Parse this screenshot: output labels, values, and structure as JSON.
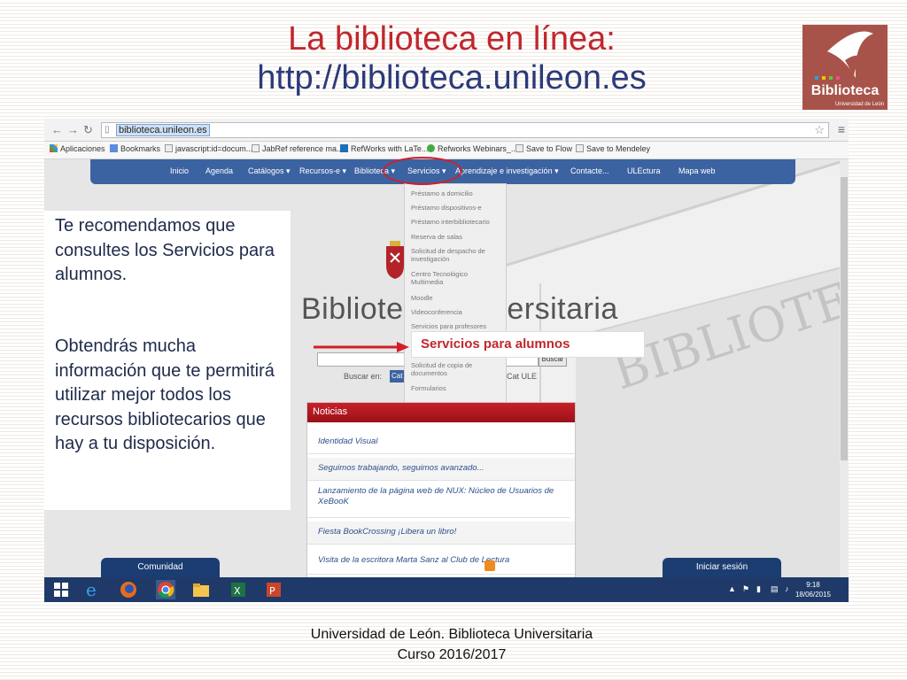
{
  "slide": {
    "title_line1": "La biblioteca en línea:",
    "title_line2": "http://biblioteca.unileon.es",
    "left_text_1": "Te recomendamos que consultes los Servicios para alumnos.",
    "left_text_2": "Obtendrás mucha información que te permitirá utilizar mejor todos los recursos bibliotecarios que hay a tu disposición.",
    "callout": "Servicios para alumnos",
    "footer_line1": "Universidad de León. Biblioteca Universitaria",
    "footer_line2": "Curso 2016/2017",
    "logo_text": "Biblioteca",
    "logo_sub": "Universidad de León"
  },
  "browser": {
    "url": "biblioteca.unileon.es",
    "bookmarks": [
      "Aplicaciones",
      "Bookmarks",
      "javascript:id=docum...",
      "JabRef reference ma...",
      "RefWorks with LaTe...",
      "Refworks Webinars_...",
      "Save to Flow",
      "Save to Mendeley"
    ]
  },
  "site": {
    "nav": [
      "Inicio",
      "Agenda",
      "Catálogos ▾",
      "Recursos-e ▾",
      "Biblioteca ▾",
      "Servicios ▾",
      "Aprendizaje e investigación ▾",
      "Contacte...",
      "ULEctura",
      "Mapa web"
    ],
    "submenu": [
      "Préstamo a domicilio",
      "Préstamo dispositivos-e",
      "Préstamo interbibliotecario",
      "Reserva de salas",
      "Solicitud de despacho de investigación",
      "Centro Tecnológico Multimedia",
      "Moodle",
      "Videoconferencia",
      "Servicios para profesores",
      "Servicios para alumnos",
      "Solicitud de copia de documentos",
      "Formularios"
    ],
    "site_name": "Biblioteca Universitaria",
    "buscar_label": "Buscar en:",
    "buscar_button": "Buscar",
    "cat_chip": "Cat",
    "cat_ule": "Cat ULE",
    "noticias_title": "Noticias",
    "noticias": [
      "Identidad Visual",
      "Seguimos trabajando, seguimos avanzado...",
      "Lanzamiento de la página web de NUX: Núcleo de Usuarios de XeBooK",
      "Fiesta BookCrossing ¡Libera un libro!",
      "Visita de la escritora Marta Sanz al Club de Lectura"
    ],
    "comunidad": "Comunidad",
    "iniciar_sesion": "Iniciar sesión",
    "wall_text": "BIBLIOTECA UNIVERSITARIA \"SAN ISIDORO\""
  },
  "taskbar": {
    "time": "9:18",
    "date": "18/06/2015"
  }
}
